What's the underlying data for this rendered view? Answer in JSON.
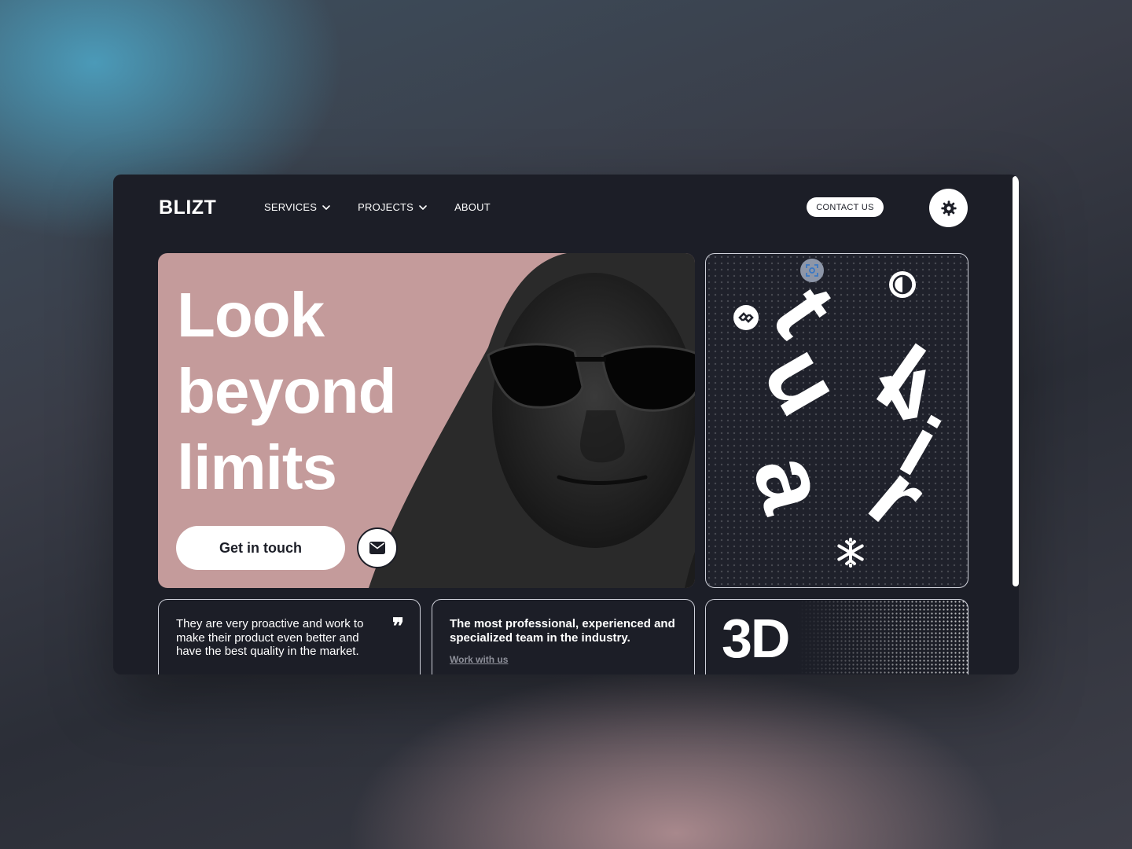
{
  "brand": {
    "logo": "BLIZT"
  },
  "nav": {
    "items": [
      {
        "label": "SERVICES",
        "has_dropdown": true
      },
      {
        "label": "PROJECTS",
        "has_dropdown": true
      },
      {
        "label": "ABOUT",
        "has_dropdown": false
      }
    ]
  },
  "header": {
    "contact_label": "CONTACT US",
    "theme_icon": "gear-icon"
  },
  "hero": {
    "title": "Look\nbeyond\nlimits",
    "cta_label": "Get in touch",
    "mail_icon": "envelope-icon",
    "background_color": "#c49b9b"
  },
  "virtual_card": {
    "letters": [
      "v",
      "i",
      "r",
      "t",
      "u",
      "a",
      "l"
    ],
    "icons": [
      "scan-icon",
      "contrast-icon",
      "link-icon",
      "snowflake-icon"
    ]
  },
  "testimonial": {
    "text": "They are very proactive and work to make their product even better and have the best quality in the market.",
    "quote_mark": "❞"
  },
  "team": {
    "text": "The most professional, experienced and specialized team in the industry.",
    "link_label": "Work with us"
  },
  "card_3d": {
    "label": "3D"
  }
}
